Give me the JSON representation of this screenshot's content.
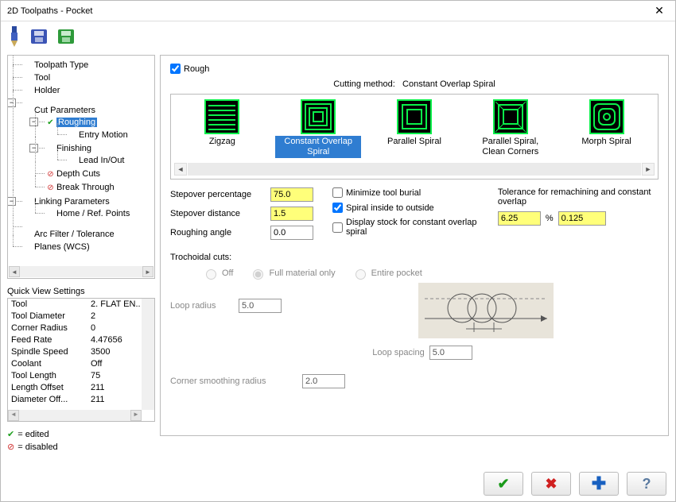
{
  "window": {
    "title": "2D Toolpaths - Pocket"
  },
  "tree": {
    "items": {
      "toolpath_type": "Toolpath Type",
      "tool": "Tool",
      "holder": "Holder",
      "cut_params": "Cut Parameters",
      "roughing": "Roughing",
      "entry_motion": "Entry Motion",
      "finishing": "Finishing",
      "lead_inout": "Lead In/Out",
      "depth_cuts": "Depth Cuts",
      "break_through": "Break Through",
      "linking_params": "Linking Parameters",
      "home_ref": "Home / Ref. Points",
      "arc_filter": "Arc Filter / Tolerance",
      "planes": "Planes (WCS)"
    }
  },
  "quickview": {
    "title": "Quick View Settings",
    "rows": [
      {
        "k": "Tool",
        "v": "2. FLAT EN.."
      },
      {
        "k": "Tool Diameter",
        "v": "2"
      },
      {
        "k": "Corner Radius",
        "v": "0"
      },
      {
        "k": "Feed Rate",
        "v": "4.47656"
      },
      {
        "k": "Spindle Speed",
        "v": "3500"
      },
      {
        "k": "Coolant",
        "v": "Off"
      },
      {
        "k": "Tool Length",
        "v": "75"
      },
      {
        "k": "Length Offset",
        "v": "211"
      },
      {
        "k": "Diameter Off...",
        "v": "211"
      }
    ]
  },
  "legend": {
    "edited": "= edited",
    "disabled": "= disabled"
  },
  "main": {
    "rough_label": "Rough",
    "cutting_method_label": "Cutting method:",
    "cutting_method_value": "Constant Overlap Spiral",
    "methods": {
      "zigzag": "Zigzag",
      "cos": "Constant Overlap Spiral",
      "parallel": "Parallel Spiral",
      "parallel_clean": "Parallel Spiral, Clean Corners",
      "morph": "Morph Spiral"
    },
    "stepover_pct_label": "Stepover percentage",
    "stepover_pct": "75.0",
    "stepover_dist_label": "Stepover distance",
    "stepover_dist": "1.5",
    "rough_angle_label": "Roughing angle",
    "rough_angle": "0.0",
    "min_burial": "Minimize tool burial",
    "spiral_inside": "Spiral inside to outside",
    "display_stock": "Display stock for constant overlap spiral",
    "tolerance_label": "Tolerance for remachining and constant overlap",
    "tol_pct": "6.25",
    "pct_sym": "%",
    "tol_val": "0.125",
    "troch": {
      "title": "Trochoidal cuts:",
      "off": "Off",
      "full": "Full material only",
      "entire": "Entire pocket",
      "loop_radius_label": "Loop radius",
      "loop_radius": "5.0",
      "loop_spacing_label": "Loop spacing",
      "loop_spacing": "5.0",
      "corner_label": "Corner smoothing radius",
      "corner": "2.0"
    }
  }
}
